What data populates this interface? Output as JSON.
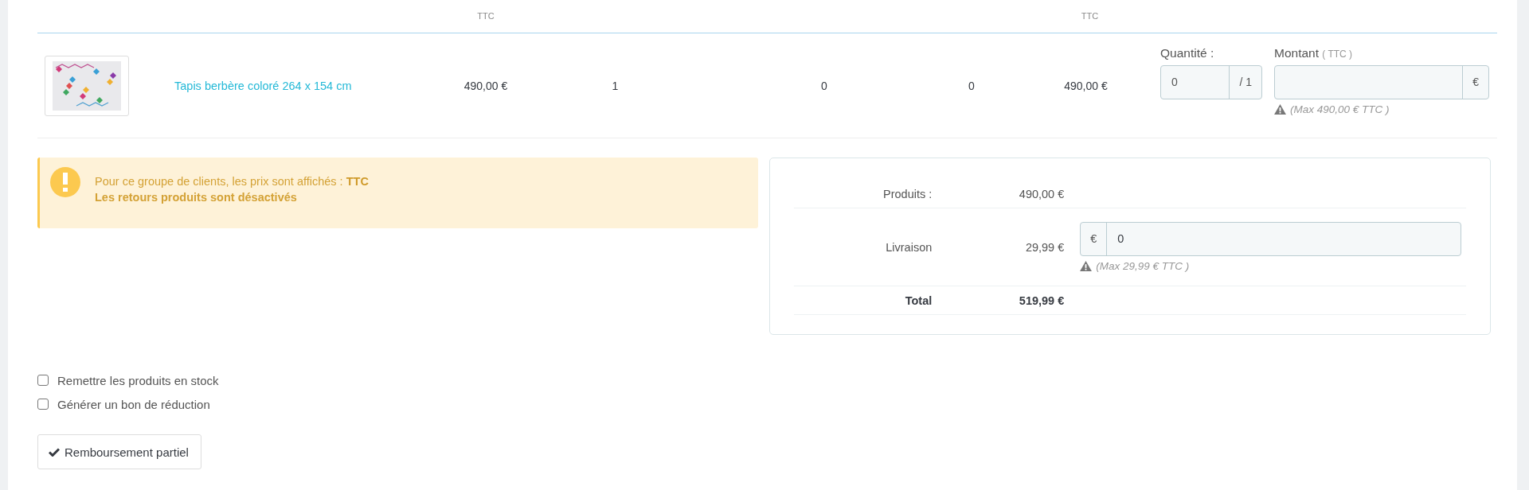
{
  "table": {
    "header": {
      "column_3": "TTC",
      "column_7": "TTC"
    },
    "rows": [
      {
        "product": "Tapis berbère coloré 264 x 154 cm",
        "cells": [
          "490,00 €",
          "1",
          "0",
          "0",
          "490,00 €"
        ],
        "refund": {
          "quantity_label": "Quantité :",
          "quantity_value": "0",
          "quantity_max": "/ 1",
          "amount_label": "Montant",
          "amount_note": "( TTC )",
          "currency": "€",
          "hint": "(Max 490,00 € TTC )"
        }
      }
    ]
  },
  "alert": {
    "message": "Pour ce groupe de clients, les prix sont affichés : **TTC**",
    "emphasis": "Les retours produits sont désactivés"
  },
  "summary": {
    "rows": [
      {
        "kind": "plain",
        "label": "Produits :",
        "value": "490,00 €"
      },
      {
        "kind": "input",
        "label": "Livraison",
        "value": "29,99 €",
        "currency": "€",
        "input_value": "0",
        "hint": "(Max 29,99 € TTC )"
      },
      {
        "kind": "total",
        "label": "Total",
        "value": "519,99 €"
      }
    ]
  },
  "options": [
    {
      "label": "Remettre les produits en stock",
      "checked": false
    },
    {
      "label": "Générer un bon de réduction",
      "checked": false
    }
  ],
  "button": {
    "label": "Remboursement partiel"
  }
}
